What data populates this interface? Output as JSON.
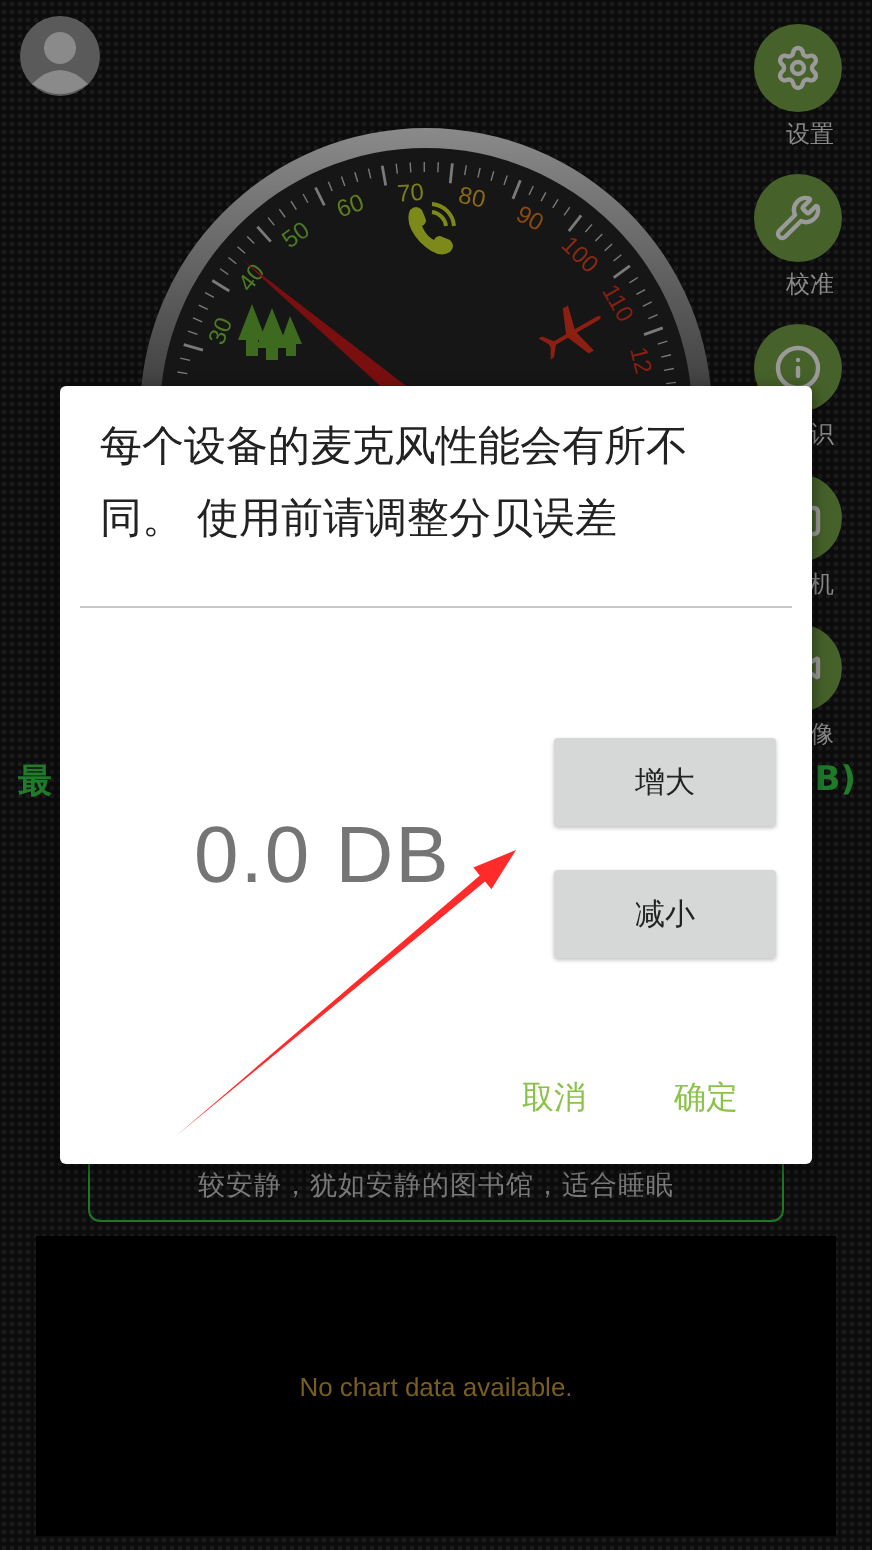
{
  "sidebar": {
    "items": [
      {
        "kind": "gear",
        "label": "设置"
      },
      {
        "kind": "wrench",
        "label": "校准"
      },
      {
        "kind": "info",
        "label": "识"
      },
      {
        "kind": "camera",
        "label": "机"
      },
      {
        "kind": "video",
        "label": "像"
      }
    ]
  },
  "gauge": {
    "level": 0.29,
    "scale": [
      {
        "label": "30",
        "color": "#4a7a24"
      },
      {
        "label": "40",
        "color": "#4a7a24"
      },
      {
        "label": "50",
        "color": "#4a7a24"
      },
      {
        "label": "60",
        "color": "#5f7d1c"
      },
      {
        "label": "70",
        "color": "#7d7f18"
      },
      {
        "label": "80",
        "color": "#8a6a10"
      },
      {
        "label": "90",
        "color": "#8a4a10"
      },
      {
        "label": "100",
        "color": "#8a2a12"
      },
      {
        "label": "110",
        "color": "#8a1f12"
      },
      {
        "label": "12",
        "color": "#8a1f12"
      }
    ]
  },
  "readings": {
    "min_label": "最",
    "max_label": "B)"
  },
  "status": "较安静，犹如安静的图书馆，适合睡眠",
  "chart": {
    "empty_message": "No chart data available."
  },
  "dialog": {
    "message": "每个设备的麦克风性能会有所不同。 使用前请调整分贝误差",
    "value": "0.0 DB",
    "buttons": [
      "增大",
      "减小"
    ],
    "actions": [
      "取消",
      "确定"
    ]
  }
}
